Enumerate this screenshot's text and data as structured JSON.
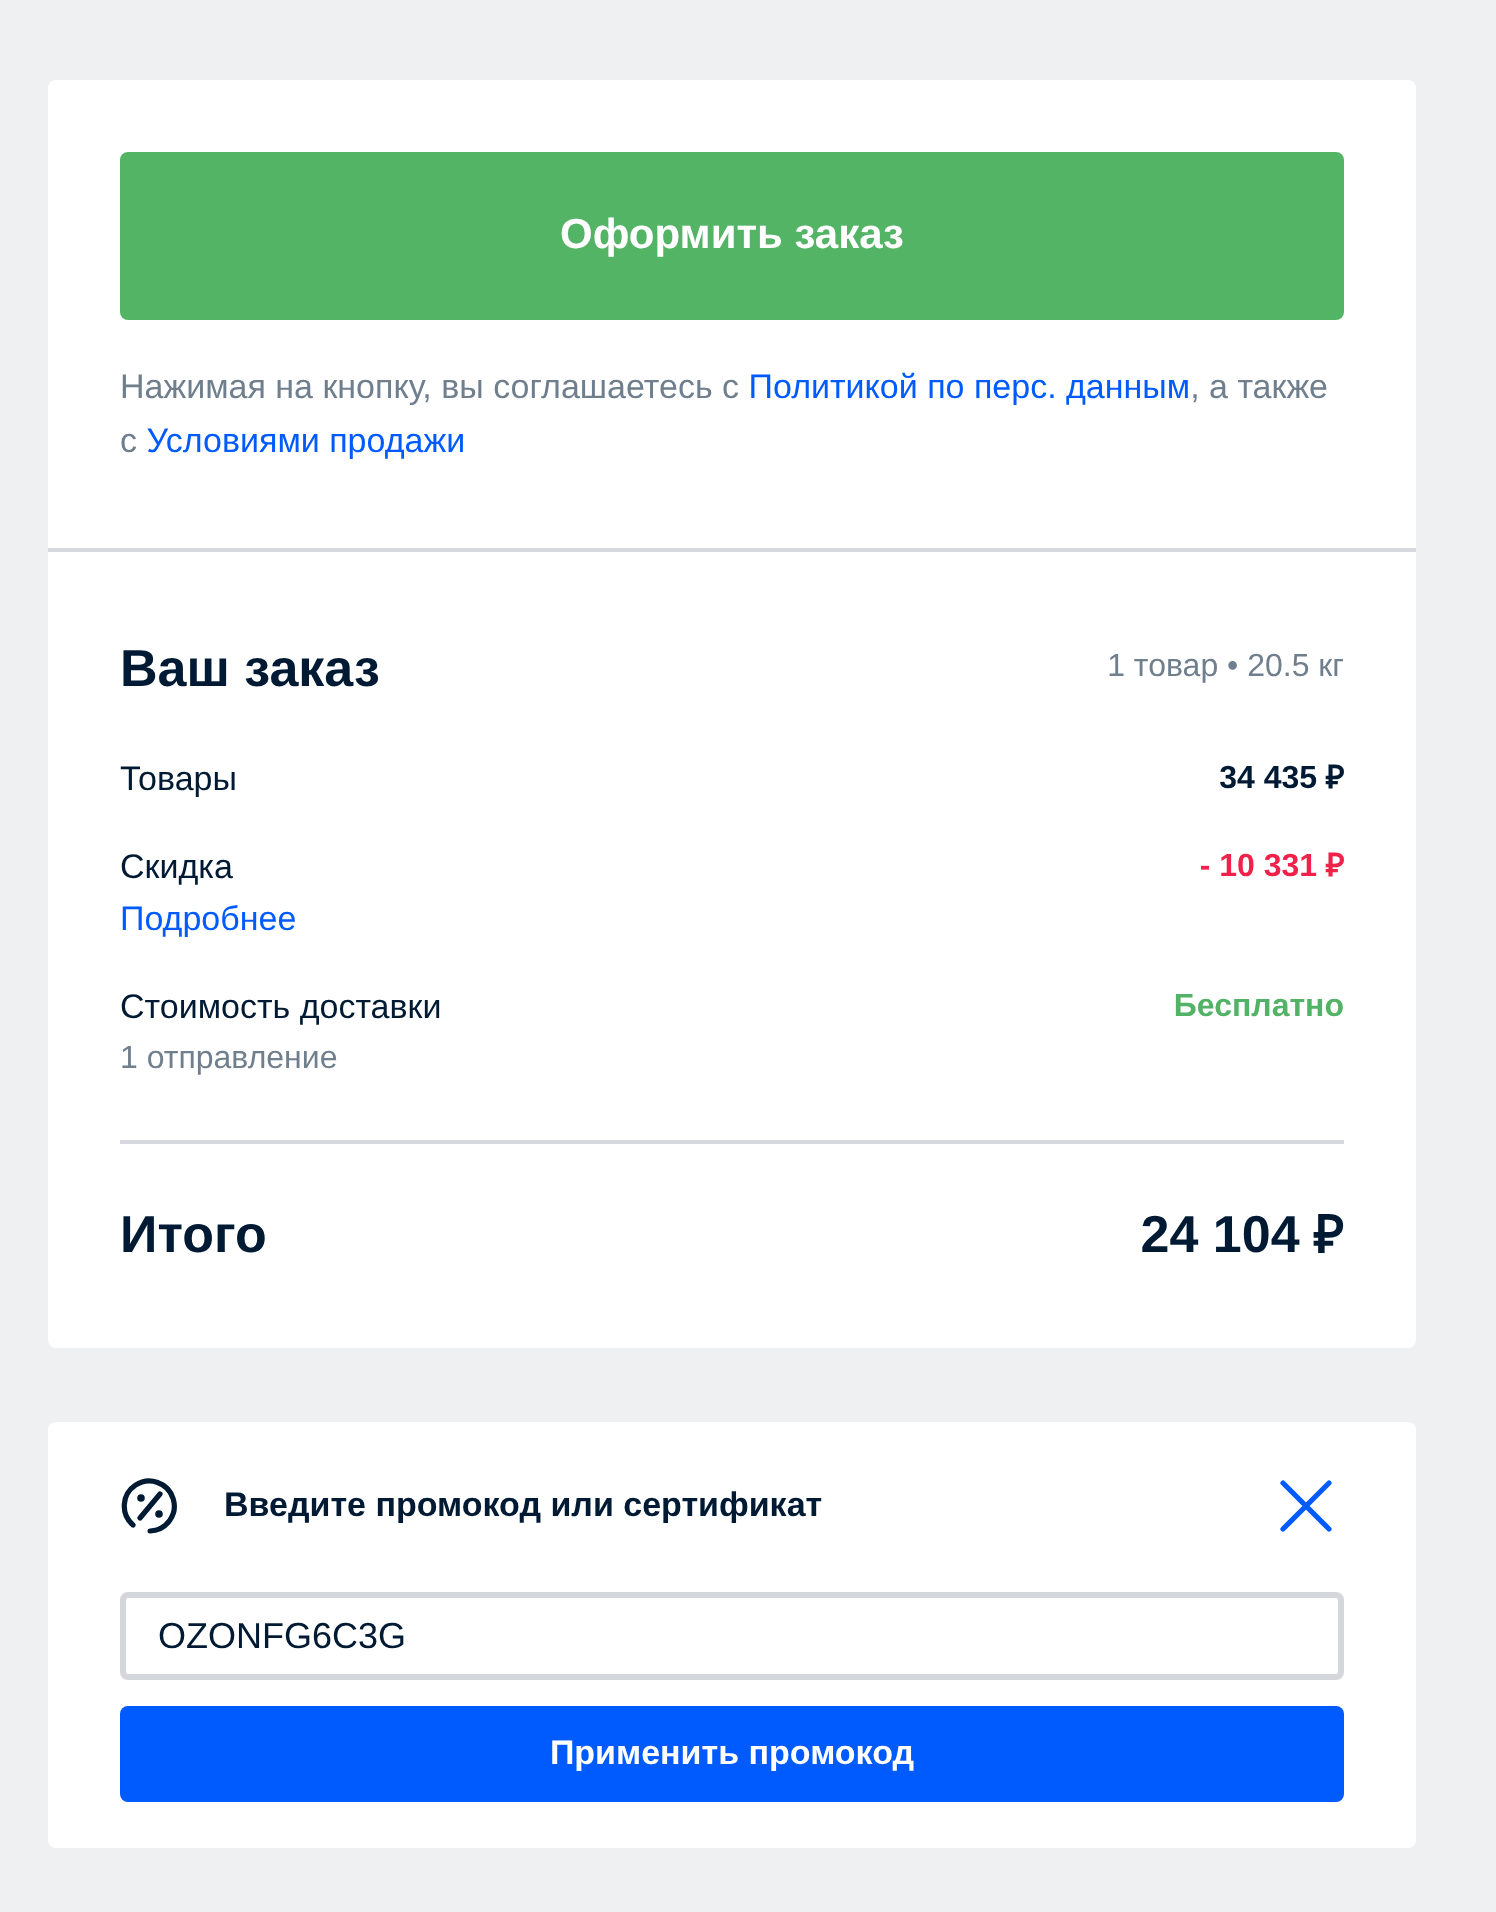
{
  "checkout": {
    "button": "Оформить заказ",
    "agreement": [
      {
        "kind": "text",
        "text": "Нажимая на кнопку, вы соглашаетесь с "
      },
      {
        "kind": "link",
        "text": "Политикой по перс. данным"
      },
      {
        "kind": "text",
        "text": ", а также с "
      },
      {
        "kind": "link",
        "text": "Условиями продажи"
      }
    ]
  },
  "summary": {
    "title": "Ваш заказ",
    "meta": "1 товар • 20.5 кг",
    "rows": [
      {
        "label": "Товары",
        "value": "34 435 ₽",
        "color": "#001a34"
      },
      {
        "label": "Скидка",
        "detail": {
          "kind": "link",
          "text": "Подробнее"
        },
        "value": "- 10 331 ₽",
        "color": "#f1224a"
      },
      {
        "label": "Стоимость доставки",
        "detail": {
          "kind": "note",
          "text": "1 отправление"
        },
        "value": "Бесплатно",
        "color": "#52b265"
      }
    ],
    "total": {
      "label": "Итого",
      "value": "24 104 ₽"
    }
  },
  "promo": {
    "title": "Введите промокод или сертификат",
    "value": "OZONFG6C3G",
    "button": "Применить промокод"
  }
}
